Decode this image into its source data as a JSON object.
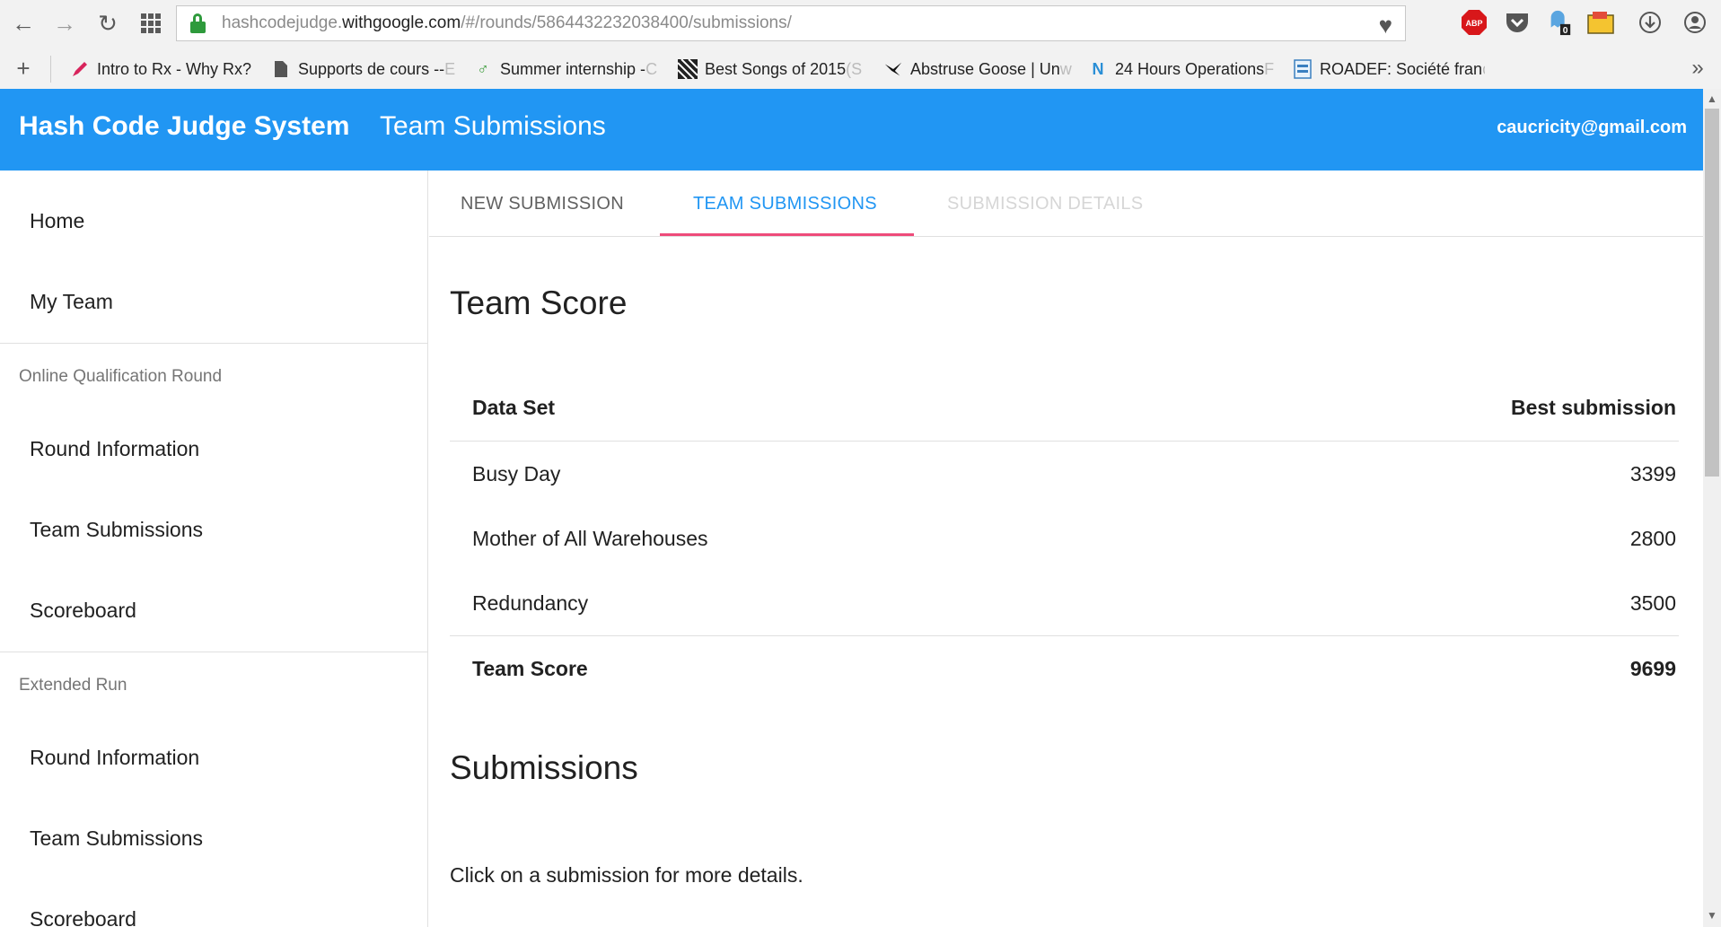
{
  "browser": {
    "url_prefix": "hashcodejudge.",
    "url_host": "withgoogle.com",
    "url_path": "/#/rounds/5864432232038400/submissions/",
    "bookmarks": [
      {
        "label": "Intro to Rx - Why Rx?",
        "fade": "",
        "icon": "pen-icon"
      },
      {
        "label": "Supports de cours -- ",
        "fade": "E",
        "icon": "page-icon"
      },
      {
        "label": "Summer internship - ",
        "fade": "C",
        "icon": "leaf-icon"
      },
      {
        "label": "Best Songs of 2015 ",
        "fade": "(S",
        "icon": "stripes-icon"
      },
      {
        "label": "Abstruse Goose | Un",
        "fade": "w",
        "icon": "goose-icon"
      },
      {
        "label": "24 Hours Operations ",
        "fade": "F",
        "icon": "n-icon"
      },
      {
        "label": "ROADEF: Société fran",
        "fade": "ç",
        "icon": "roadef-icon"
      }
    ],
    "extension_badge": "0",
    "adblock_label": "ABP"
  },
  "header": {
    "title": "Hash Code Judge System",
    "subtitle": "Team Submissions",
    "user_email": "caucricity@gmail.com",
    "color": "#2196f3"
  },
  "sidebar": {
    "home": "Home",
    "my_team": "My Team",
    "sections": [
      {
        "heading": "Online Qualification Round",
        "items": [
          "Round Information",
          "Team Submissions",
          "Scoreboard"
        ]
      },
      {
        "heading": "Extended Run",
        "items": [
          "Round Information",
          "Team Submissions",
          "Scoreboard"
        ]
      }
    ]
  },
  "tabs": [
    {
      "label": "NEW SUBMISSION",
      "state": "normal"
    },
    {
      "label": "TEAM SUBMISSIONS",
      "state": "active"
    },
    {
      "label": "SUBMISSION DETAILS",
      "state": "disabled"
    }
  ],
  "accent_color": "#ee4b7a",
  "team_score": {
    "heading": "Team Score",
    "col_dataset": "Data Set",
    "col_best": "Best submission",
    "rows": [
      {
        "name": "Busy Day",
        "score": "3399"
      },
      {
        "name": "Mother of All Warehouses",
        "score": "2800"
      },
      {
        "name": "Redundancy",
        "score": "3500"
      }
    ],
    "total_label": "Team Score",
    "total_value": "9699"
  },
  "submissions": {
    "heading": "Submissions",
    "hint": "Click on a submission for more details."
  }
}
